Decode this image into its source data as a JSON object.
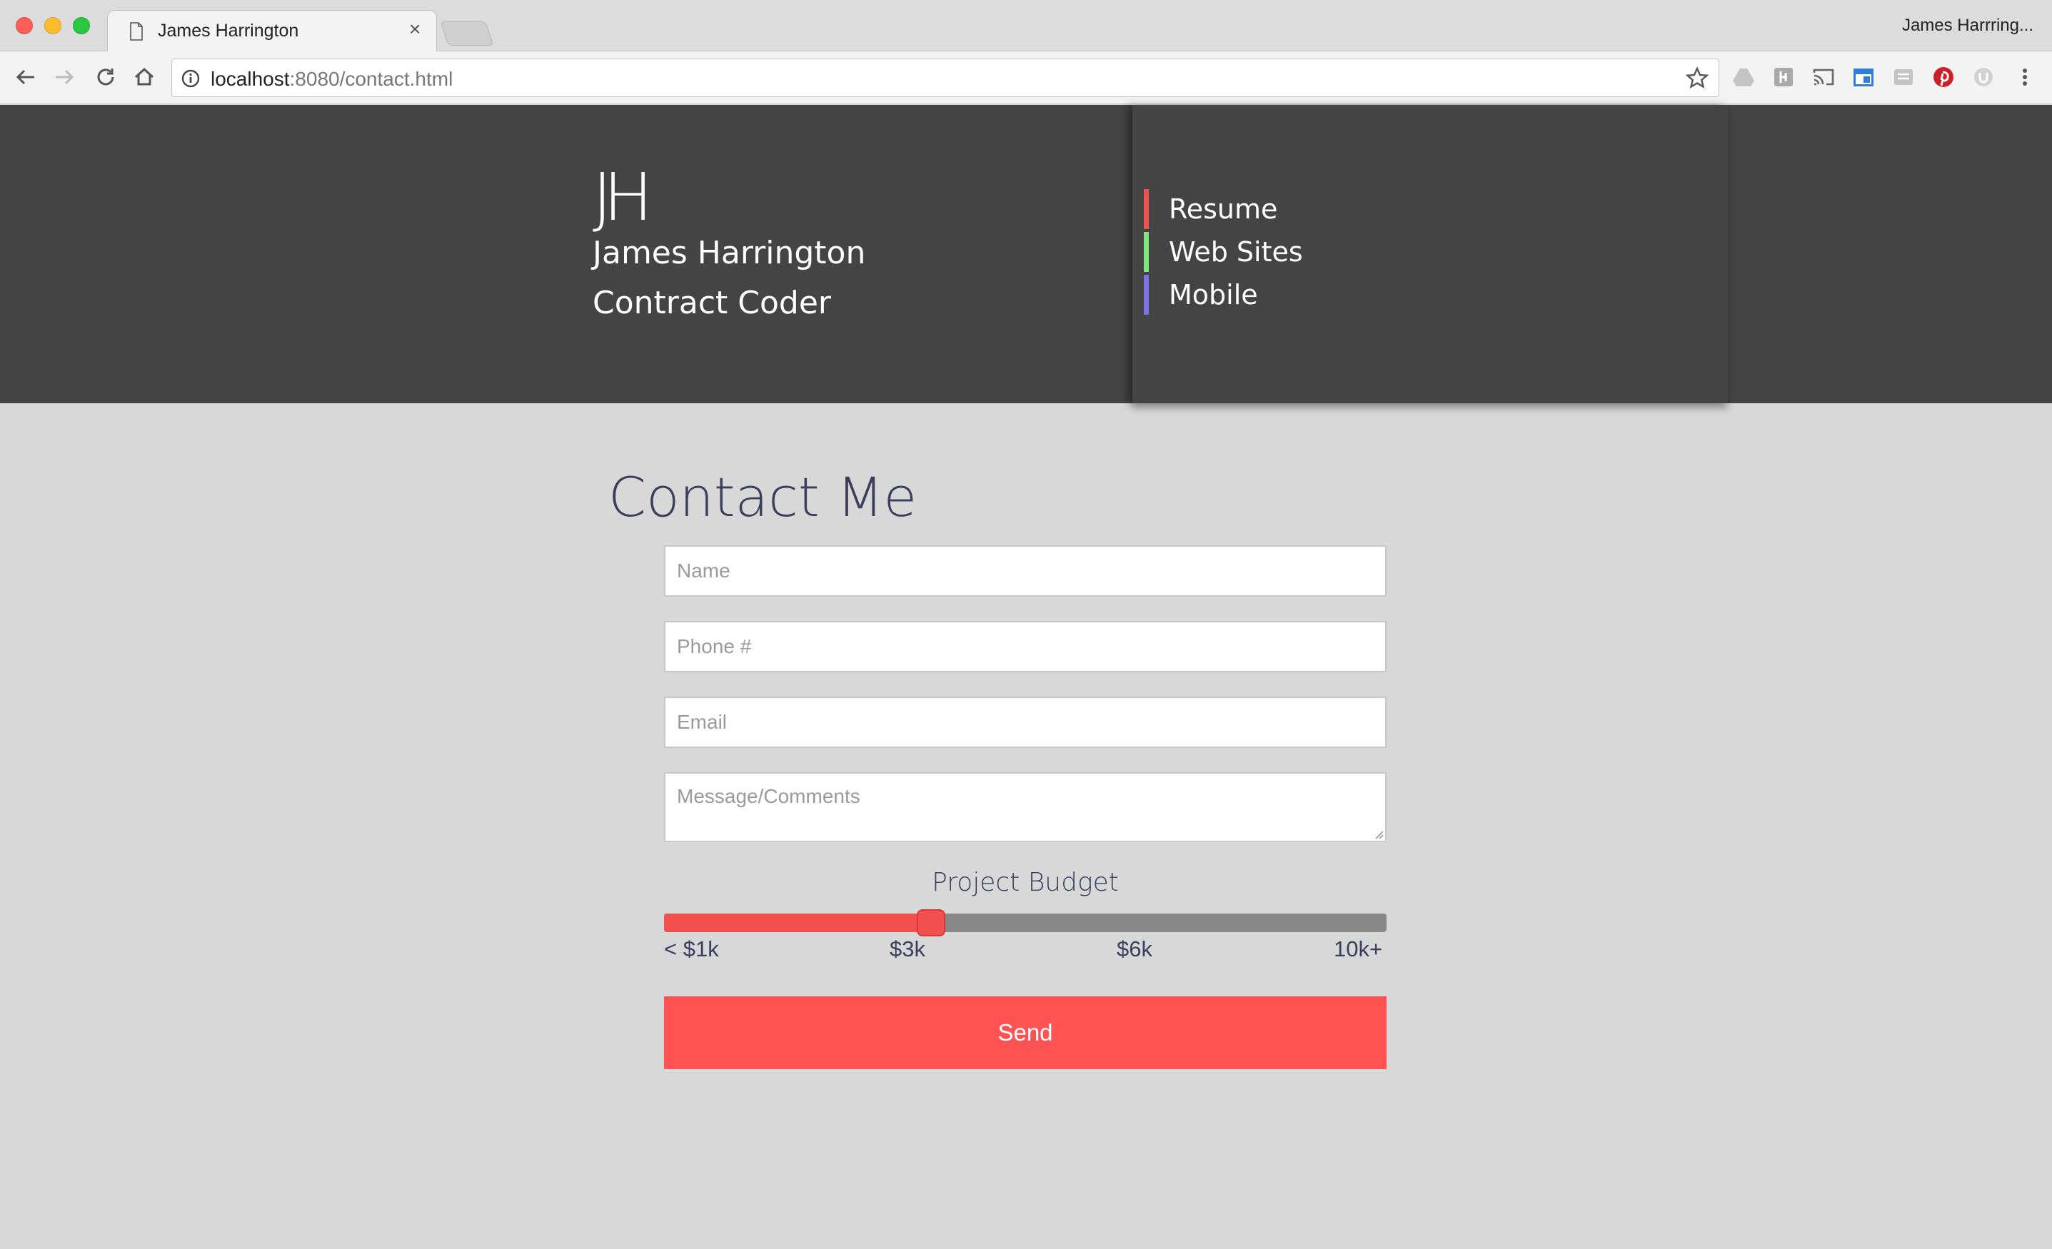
{
  "browser": {
    "tab_title": "James Harrington",
    "tab_close": "×",
    "profile_name": "James Harrring...",
    "url_host": "localhost",
    "url_rest": ":8080/contact.html"
  },
  "header": {
    "monogram": "JH",
    "name": "James Harrington",
    "role": "Contract Coder",
    "nav": [
      {
        "label": "Resume",
        "color": "#f05050"
      },
      {
        "label": "Web Sites",
        "color": "#7ee67a"
      },
      {
        "label": "Mobile",
        "color": "#7b72e9"
      }
    ]
  },
  "contact": {
    "title": "Contact Me",
    "fields": {
      "name_placeholder": "Name",
      "phone_placeholder": "Phone #",
      "email_placeholder": "Email",
      "message_placeholder": "Message/Comments"
    },
    "budget": {
      "label": "Project Budget",
      "ticks": [
        "< $1k",
        "$3k",
        "$6k",
        "10k+"
      ],
      "value_fraction": 0.37
    },
    "send_label": "Send"
  },
  "colors": {
    "accent": "#ff5252",
    "header_bg": "#444444",
    "page_bg": "#d8d8d8",
    "title_text": "#3d3d5c"
  },
  "icons": [
    "back-icon",
    "forward-icon",
    "reload-icon",
    "home-icon",
    "info-icon",
    "bookmark-star-icon",
    "drive-icon",
    "extension-icon",
    "cast-icon",
    "calendar-icon",
    "reader-icon",
    "pinterest-icon",
    "ublock-icon",
    "menu-dots-icon",
    "page-icon"
  ]
}
